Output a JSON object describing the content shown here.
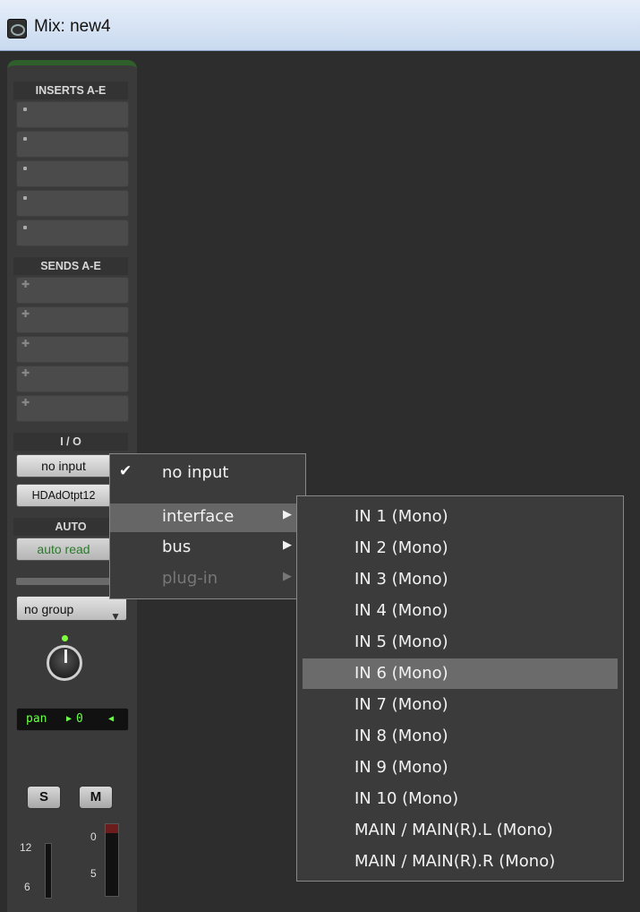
{
  "window": {
    "title": "Mix: new4",
    "icon": "pro-tools-app-icon"
  },
  "strip": {
    "inserts_label": "INSERTS A-E",
    "sends_label": "SENDS A-E",
    "io_label": "I / O",
    "input_value": "no input",
    "output_value": "HDAdOtpt12",
    "auto_label": "AUTO",
    "auto_value": "auto read",
    "group_value": "no group",
    "pan_label": "pan",
    "pan_value": "0",
    "solo_label": "S",
    "mute_label": "M",
    "meter_left_scale": [
      "12",
      "6"
    ],
    "meter_right_scale": [
      "0",
      "5"
    ]
  },
  "input_menu": {
    "items": [
      {
        "label": "no input",
        "checked": true
      },
      {
        "label": "interface",
        "submenu": true,
        "selected": true
      },
      {
        "label": "bus",
        "submenu": true
      },
      {
        "label": "plug-in",
        "submenu": true,
        "disabled": true
      }
    ]
  },
  "interface_submenu": {
    "items": [
      "IN 1 (Mono)",
      "IN 2 (Mono)",
      "IN 3 (Mono)",
      "IN 4 (Mono)",
      "IN 5 (Mono)",
      "IN 6 (Mono)",
      "IN 7 (Mono)",
      "IN 8 (Mono)",
      "IN 9 (Mono)",
      "IN 10 (Mono)",
      "MAIN / MAIN(R).L (Mono)",
      "MAIN / MAIN(R).R (Mono)"
    ],
    "highlighted": "IN 6 (Mono)"
  },
  "colors": {
    "highlight": "#6b6b6b",
    "track_color": "#2f5f2a",
    "pan_text": "#6dff4a"
  }
}
